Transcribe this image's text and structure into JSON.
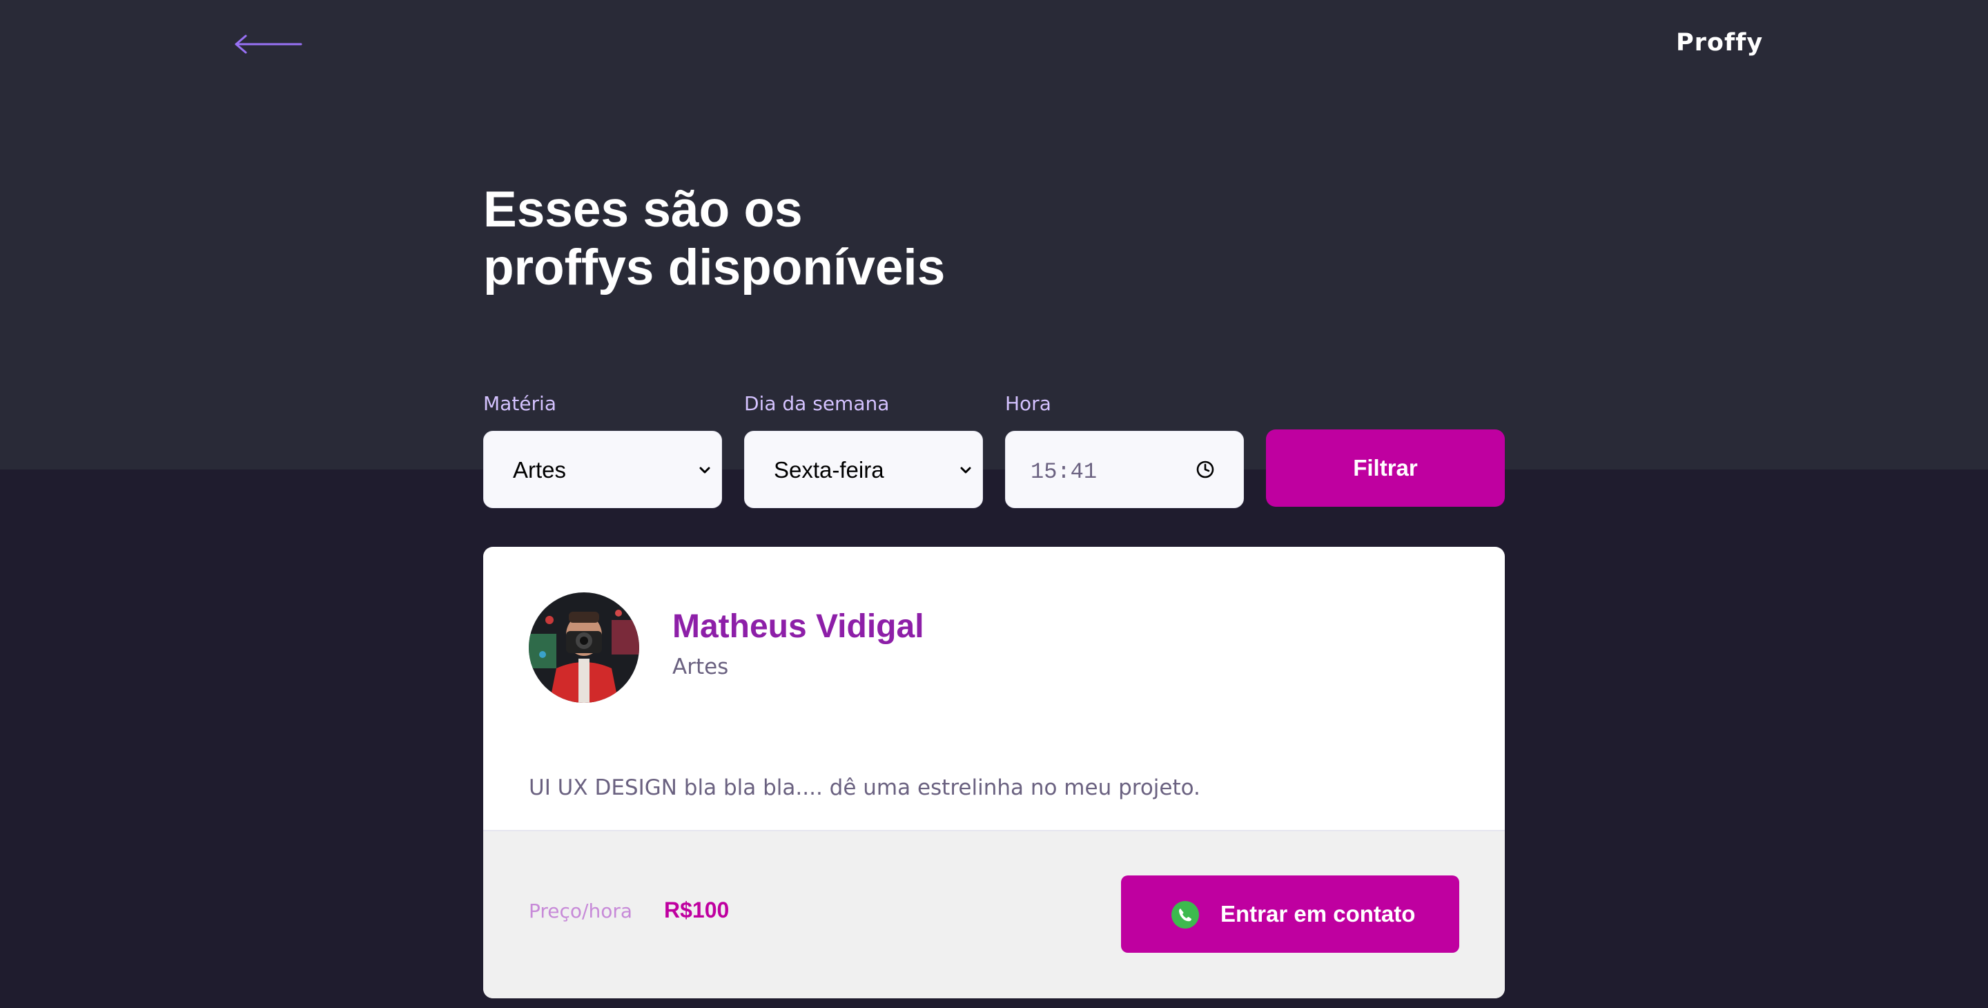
{
  "header": {
    "brand": "Proffy",
    "back_icon": "arrow-left-icon"
  },
  "page": {
    "title": "Esses são os\nproffys disponíveis"
  },
  "filters": {
    "subject": {
      "label": "Matéria",
      "value": "Artes"
    },
    "weekday": {
      "label": "Dia da semana",
      "value": "Sexta-feira"
    },
    "time": {
      "label": "Hora",
      "value": "15:41"
    },
    "submit_label": "Filtrar"
  },
  "teacher": {
    "name": "Matheus Vidigal",
    "subject": "Artes",
    "bio": "UI UX DESIGN bla bla bla.... dê uma estrelinha no meu projeto.",
    "price_label": "Preço/hora",
    "price_value": "R$100",
    "contact_label": "Entrar em contato",
    "contact_icon": "whatsapp-icon"
  },
  "colors": {
    "header_bg": "#292a37",
    "page_bg": "#1f1c2e",
    "accent": "#bf00a0",
    "name": "#8d1fa8",
    "label": "#d4c2ff"
  }
}
